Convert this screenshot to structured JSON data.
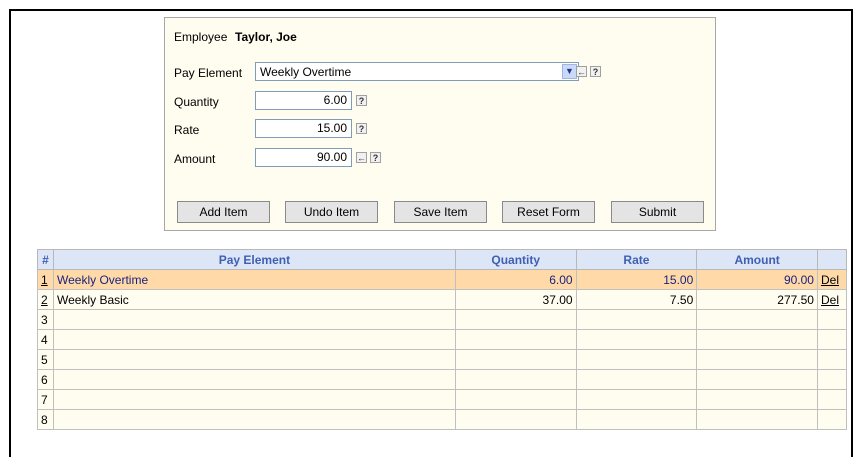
{
  "form": {
    "employee_label": "Employee",
    "employee_name": "Taylor, Joe",
    "pay_element_label": "Pay Element",
    "pay_element_value": "Weekly Overtime",
    "quantity_label": "Quantity",
    "quantity_value": "6.00",
    "rate_label": "Rate",
    "rate_value": "15.00",
    "amount_label": "Amount",
    "amount_value": "90.00",
    "help_glyph": "?",
    "back_glyph": "←"
  },
  "buttons": {
    "add_item": "Add Item",
    "undo_item": "Undo Item",
    "save_item": "Save Item",
    "reset_form": "Reset Form",
    "submit": "Submit"
  },
  "table": {
    "headers": {
      "index": "#",
      "pay_element": "Pay Element",
      "quantity": "Quantity",
      "rate": "Rate",
      "amount": "Amount"
    },
    "rows": [
      {
        "index": "1",
        "pay_element": "Weekly Overtime",
        "quantity": "6.00",
        "rate": "15.00",
        "amount": "90.00",
        "action": "Del"
      },
      {
        "index": "2",
        "pay_element": "Weekly Basic",
        "quantity": "37.00",
        "rate": "7.50",
        "amount": "277.50",
        "action": "Del"
      },
      {
        "index": "3",
        "pay_element": "",
        "quantity": "",
        "rate": "",
        "amount": "",
        "action": ""
      },
      {
        "index": "4",
        "pay_element": "",
        "quantity": "",
        "rate": "",
        "amount": "",
        "action": ""
      },
      {
        "index": "5",
        "pay_element": "",
        "quantity": "",
        "rate": "",
        "amount": "",
        "action": ""
      },
      {
        "index": "6",
        "pay_element": "",
        "quantity": "",
        "rate": "",
        "amount": "",
        "action": ""
      },
      {
        "index": "7",
        "pay_element": "",
        "quantity": "",
        "rate": "",
        "amount": "",
        "action": ""
      },
      {
        "index": "8",
        "pay_element": "",
        "quantity": "",
        "rate": "",
        "amount": "",
        "action": ""
      }
    ]
  },
  "colors": {
    "selected_row": "#ffd9a8",
    "header_bg": "#dde6f7",
    "header_text": "#3f5fb3",
    "panel_bg": "#fffdf0"
  }
}
